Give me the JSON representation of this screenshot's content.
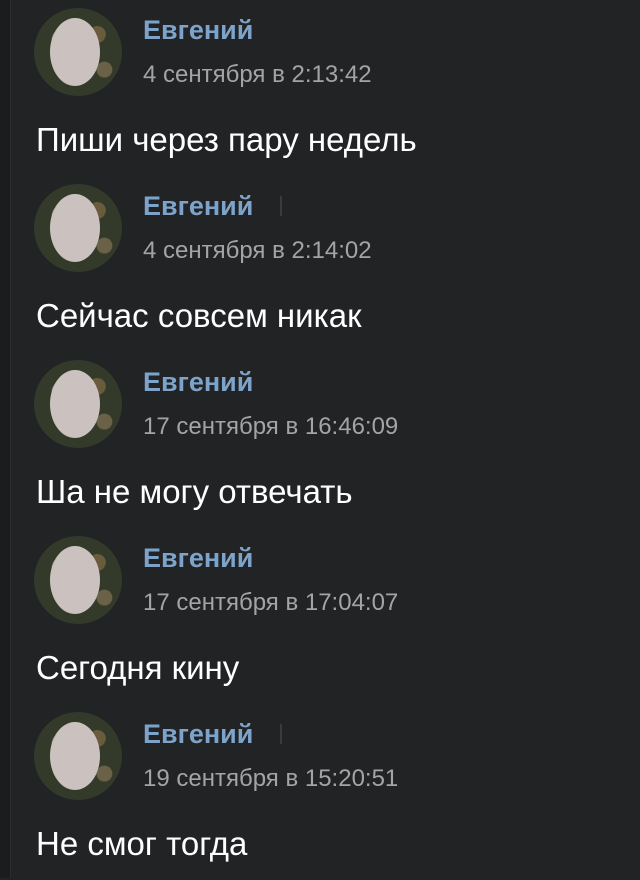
{
  "messages": [
    {
      "author": "Евгений",
      "timestamp": "4 сентября в 2:13:42",
      "text": "Пиши через пару недель"
    },
    {
      "author": "Евгений",
      "timestamp": "4 сентября в 2:14:02",
      "text": "Сейчас совсем никак"
    },
    {
      "author": "Евгений",
      "timestamp": "17 сентября в 16:46:09",
      "text": "Ша не могу отвечать"
    },
    {
      "author": "Евгений",
      "timestamp": "17 сентября в 17:04:07",
      "text": "Сегодня кину"
    },
    {
      "author": "Евгений",
      "timestamp": "19 сентября в 15:20:51",
      "text": "Не смог тогда"
    }
  ]
}
